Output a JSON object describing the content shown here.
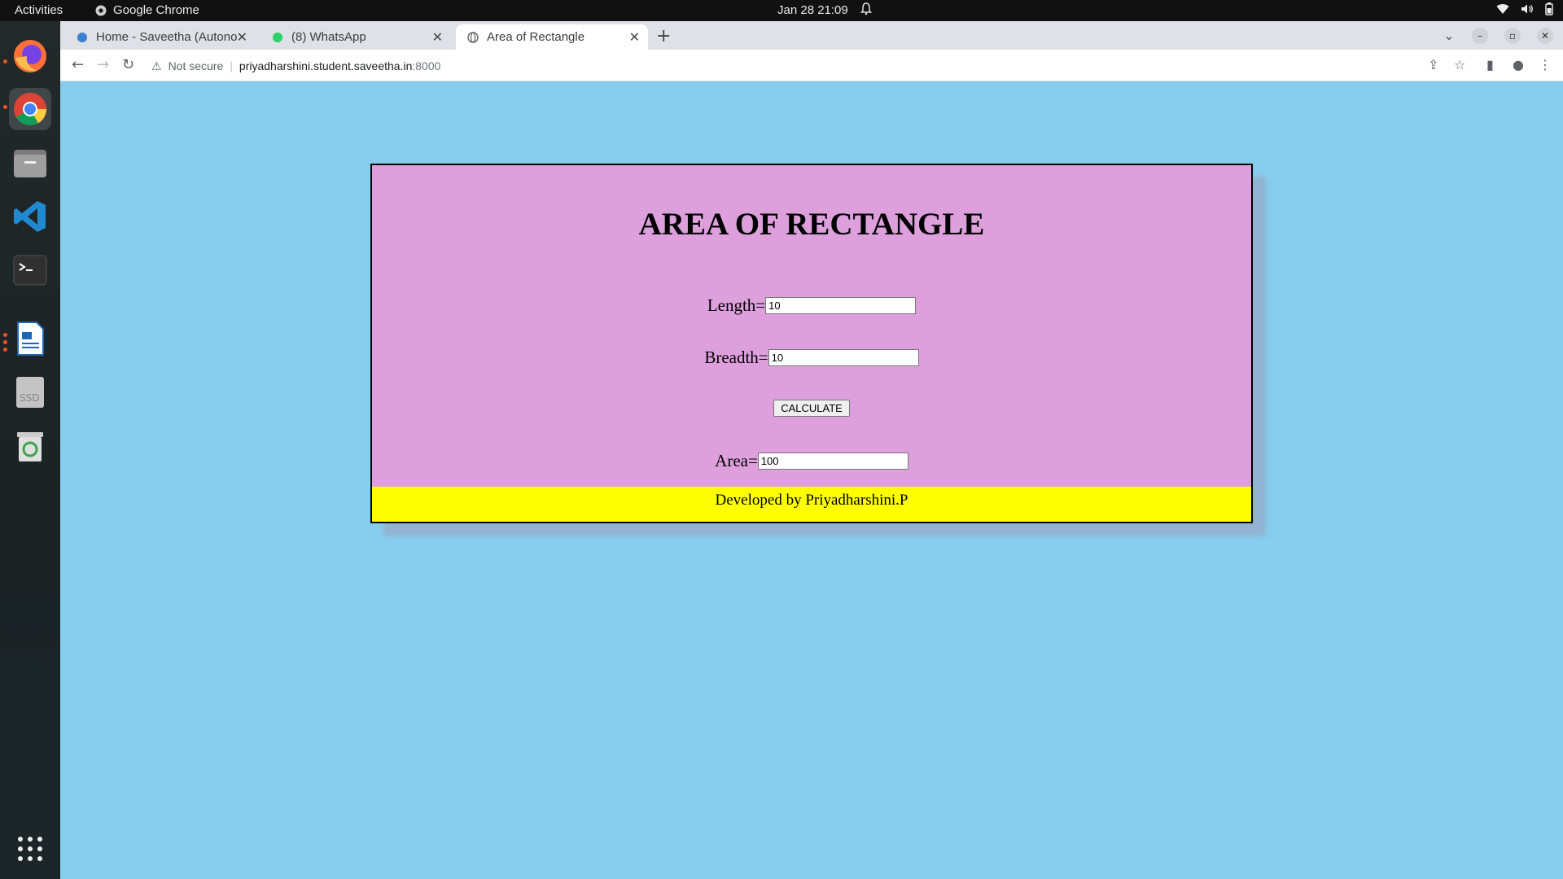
{
  "system": {
    "activities": "Activities",
    "app_name": "Google Chrome",
    "clock": "Jan 28  21:09"
  },
  "tabs": [
    {
      "title": "Home - Saveetha (Autono",
      "active": false
    },
    {
      "title": "(8) WhatsApp",
      "active": false
    },
    {
      "title": "Area of Rectangle",
      "active": true
    }
  ],
  "address": {
    "security": "Not secure",
    "host": "priyadharshini.student.saveetha.in",
    "port": ":8000"
  },
  "page": {
    "heading": "AREA OF RECTANGLE",
    "length_label": "Length=",
    "length_value": "10",
    "breadth_label": "Breadth=",
    "breadth_value": "10",
    "button_label": "CALCULATE",
    "area_label": "Area=",
    "area_value": "100",
    "footer": "Developed by Priyadharshini.P"
  },
  "colors": {
    "page_bg": "#87ceee",
    "card_bg": "#dda0dd",
    "footer_bg": "#ffff00"
  }
}
